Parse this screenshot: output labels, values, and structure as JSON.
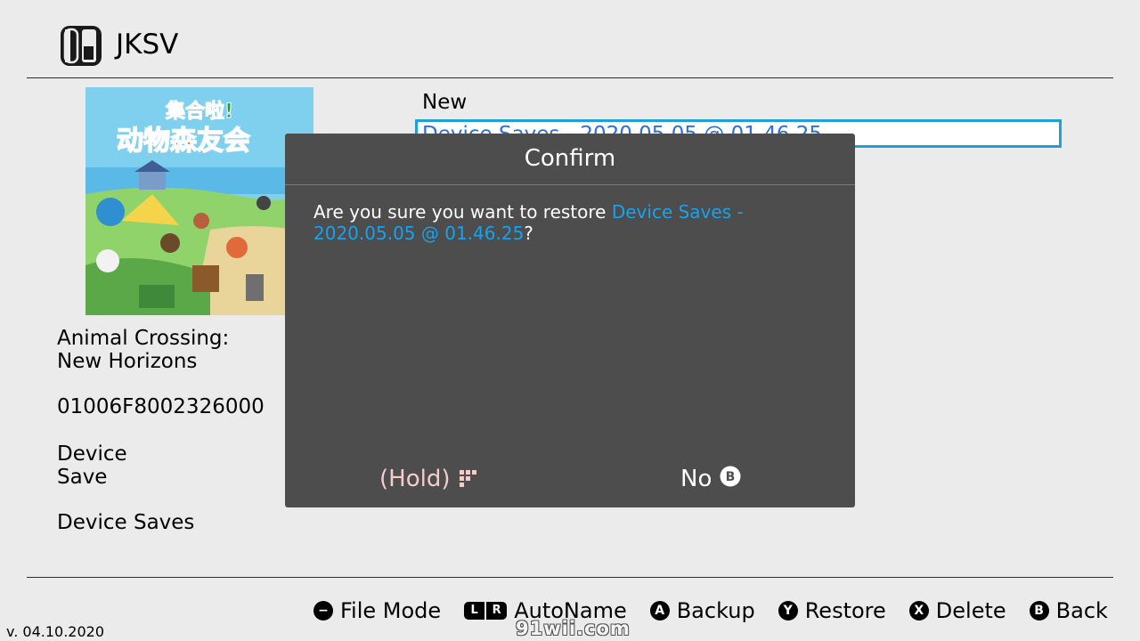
{
  "header": {
    "title": "JKSV"
  },
  "game": {
    "cover_logo_line1": "集合啦!",
    "cover_logo_line2": "动物森友会",
    "title": "Animal Crossing:\nNew Horizons",
    "title_id": "01006F8002326000",
    "save_type": "Device\nSave",
    "folder": "Device Saves"
  },
  "list": {
    "items": [
      {
        "label": "New"
      },
      {
        "label": "Device Saves - 2020.05.05 @ 01.46.25"
      }
    ]
  },
  "dialog": {
    "title": "Confirm",
    "message_prefix": "Are you sure you want to restore ",
    "message_target": "Device Saves - 2020.05.05 @ 01.46.25",
    "message_suffix": "?",
    "yes_label": "(Hold)",
    "no_label": "No",
    "no_button_glyph": "B"
  },
  "footer": {
    "hints": [
      {
        "button": "−",
        "label": "File Mode"
      },
      {
        "button_l": "L",
        "button_r": "R",
        "label": "AutoName"
      },
      {
        "button": "A",
        "label": "Backup"
      },
      {
        "button": "Y",
        "label": "Restore"
      },
      {
        "button": "X",
        "label": "Delete"
      },
      {
        "button": "B",
        "label": "Back"
      }
    ],
    "version": "v. 04.10.2020",
    "watermark": "91wii.com"
  },
  "colors": {
    "background": "#ebebeb",
    "dialog_bg": "#4d4d4d",
    "highlight_text": "#17a2ef",
    "selection_border": "#1fa1d6",
    "hold_text": "#f4cccc"
  }
}
